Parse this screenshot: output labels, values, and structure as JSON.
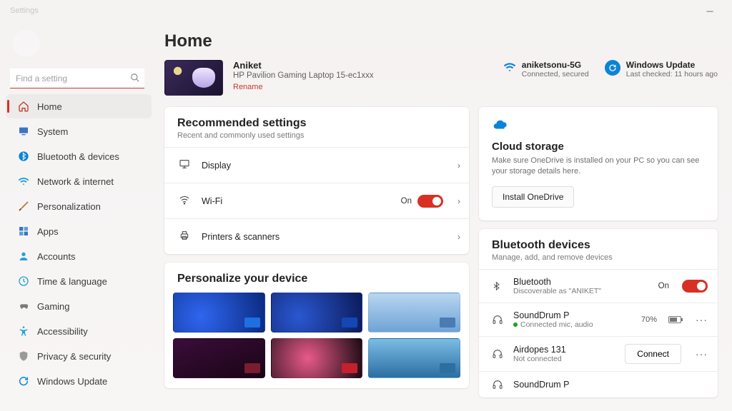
{
  "titlebar": {
    "app_label": "Settings"
  },
  "search": {
    "placeholder": "Find a setting"
  },
  "nav": {
    "items": [
      {
        "label": "Home"
      },
      {
        "label": "System"
      },
      {
        "label": "Bluetooth & devices"
      },
      {
        "label": "Network & internet"
      },
      {
        "label": "Personalization"
      },
      {
        "label": "Apps"
      },
      {
        "label": "Accounts"
      },
      {
        "label": "Time & language"
      },
      {
        "label": "Gaming"
      },
      {
        "label": "Accessibility"
      },
      {
        "label": "Privacy & security"
      },
      {
        "label": "Windows Update"
      }
    ]
  },
  "page": {
    "title": "Home"
  },
  "device": {
    "name": "Aniket",
    "model": "HP Pavilion Gaming Laptop 15-ec1xxx",
    "rename": "Rename"
  },
  "status": {
    "wifi": {
      "name": "aniketsonu-5G",
      "sub": "Connected, secured"
    },
    "update": {
      "name": "Windows Update",
      "sub": "Last checked: 11 hours ago"
    }
  },
  "recommended": {
    "title": "Recommended settings",
    "sub": "Recent and commonly used settings",
    "items": {
      "display": "Display",
      "wifi": "Wi-Fi",
      "wifi_state": "On",
      "printers": "Printers & scanners"
    }
  },
  "personalize": {
    "title": "Personalize your device"
  },
  "cloud": {
    "title": "Cloud storage",
    "desc": "Make sure OneDrive is installed on your PC so you can see your storage details here.",
    "button": "Install OneDrive"
  },
  "bluetooth": {
    "title": "Bluetooth devices",
    "sub": "Manage, add, and remove devices",
    "toggle_state": "On",
    "self": {
      "name": "Bluetooth",
      "sub": "Discoverable as \"ANIKET\""
    },
    "d1": {
      "name": "SoundDrum P",
      "sub": "Connected mic, audio",
      "pct": "70%"
    },
    "d2": {
      "name": "Airdopes 131",
      "sub": "Not connected",
      "action": "Connect"
    },
    "d3": {
      "name": "SoundDrum P"
    }
  }
}
